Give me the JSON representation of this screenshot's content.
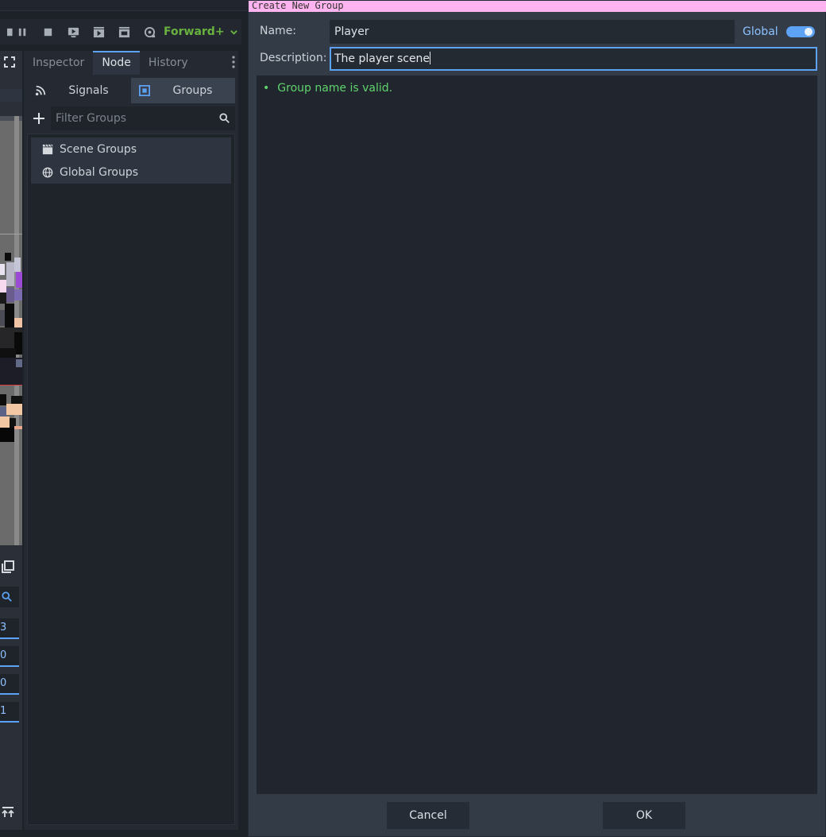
{
  "renderer": {
    "label": "Forward+"
  },
  "dock": {
    "tabs": [
      "Inspector",
      "Node",
      "History"
    ],
    "subtabs": {
      "signals": "Signals",
      "groups": "Groups"
    },
    "filter_placeholder": "Filter Groups",
    "groups": {
      "scene": "Scene Groups",
      "global": "Global Groups"
    }
  },
  "viewport": {
    "fields": [
      "3",
      "0",
      "0",
      "1"
    ]
  },
  "dialog": {
    "title": "Create New Group",
    "name_label": "Name:",
    "name_value": "Player",
    "global_label": "Global",
    "global_on": true,
    "description_label": "Description:",
    "description_value": "The player scene",
    "bullet": "•",
    "message": "Group name is valid.",
    "cancel": "Cancel",
    "ok": "OK"
  },
  "colors": {
    "accent": "#5ea2f5",
    "valid": "#5fd36c",
    "renderer": "#69b23f",
    "title_bar": "#ffb3ef"
  }
}
